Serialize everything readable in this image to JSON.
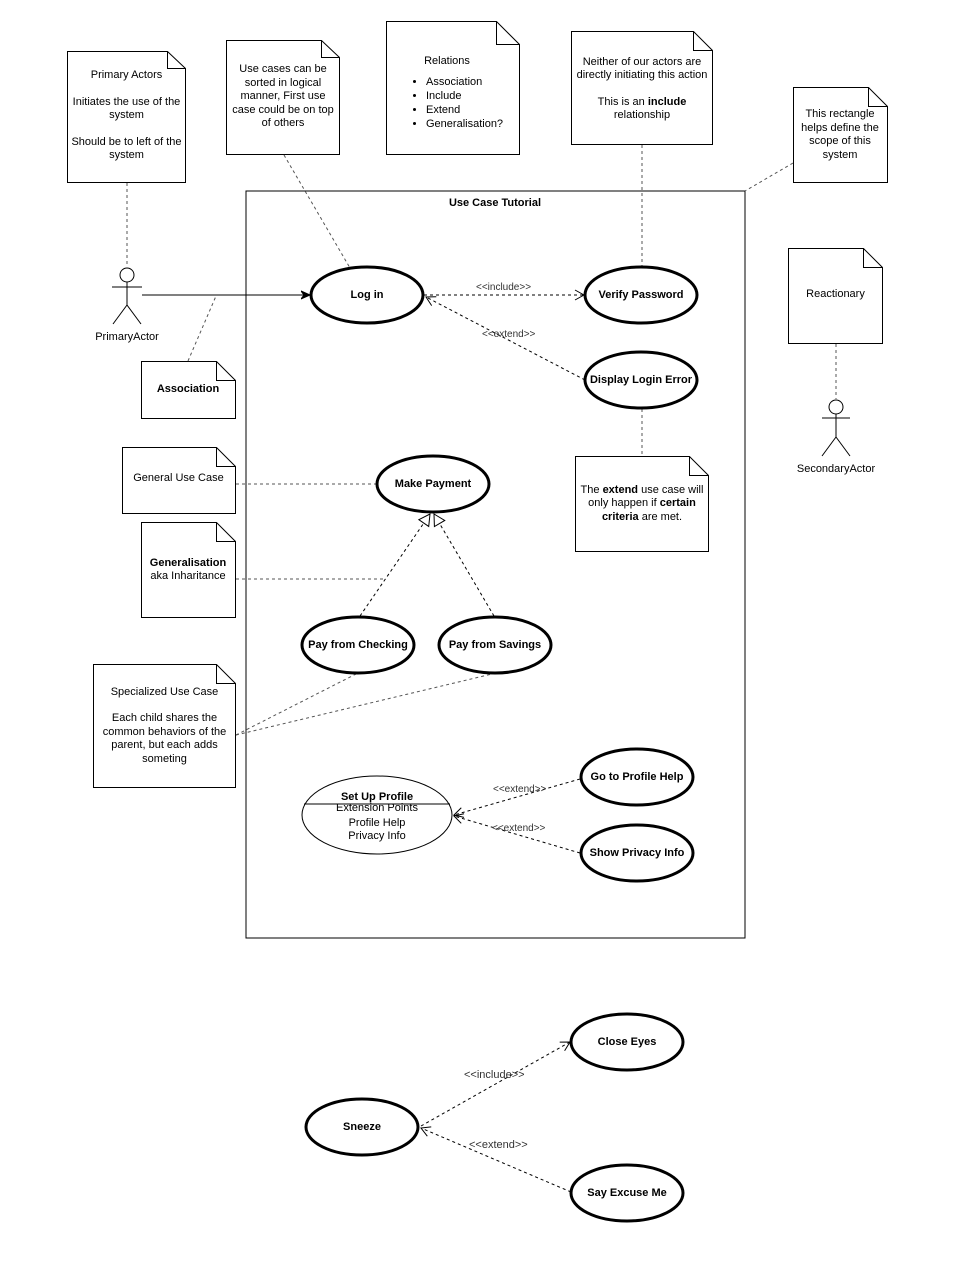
{
  "system": {
    "title": "Use Case Tutorial"
  },
  "actors": {
    "primary": {
      "label": "PrimaryActor"
    },
    "secondary": {
      "label": "SecondaryActor"
    }
  },
  "use_cases": {
    "login": "Log in",
    "verify_password": "Verify Password",
    "display_login_error": "Display Login Error",
    "make_payment": "Make Payment",
    "pay_checking": "Pay from Checking",
    "pay_savings": "Pay from Savings",
    "setup_profile": {
      "title": "Set Up Profile",
      "compartment_title": "Extension Points",
      "points": [
        "Profile Help",
        "Privacy Info"
      ]
    },
    "profile_help": "Go to Profile Help",
    "privacy_info": "Show Privacy Info",
    "sneeze": "Sneeze",
    "close_eyes": "Close Eyes",
    "say_excuse": "Say Excuse Me"
  },
  "edge_labels": {
    "login_include": "<<include>>",
    "login_extend": "<<extend>>",
    "profile_extend_1": "<<extend>>",
    "profile_extend_2": "<<extend>>",
    "sneeze_include": "<<include>>",
    "sneeze_extend": "<<extend>>"
  },
  "notes": {
    "primary_actors": {
      "title": "Primary Actors",
      "line1": "Initiates the use of the system",
      "line2": "Should be to left of the system"
    },
    "sorting": "Use cases can be sorted in logical manner, First use case could be on top of others",
    "relations": {
      "title": "Relations",
      "items": [
        "Association",
        "Include",
        "Extend",
        "Generalisation?"
      ]
    },
    "include_note": {
      "line1": "Neither of our actors are directly initiating this action",
      "pre": "This is an ",
      "bold": "include",
      "post": " relationship"
    },
    "scope": "This rectangle helps define the scope of this system",
    "reactionary": "Reactionary",
    "association": "Association",
    "extend_note": {
      "t1": "The ",
      "b1": "extend",
      "t2": " use case will only happen if ",
      "b2": "certain criteria",
      "t3": " are met."
    },
    "general_use_case": "General Use Case",
    "generalisation": {
      "bold": "Generalisation",
      "rest": "aka Inharitance"
    },
    "specialized": {
      "title": "Specialized Use Case",
      "body": "Each child shares the common behaviors of the parent, but each adds someting"
    }
  }
}
